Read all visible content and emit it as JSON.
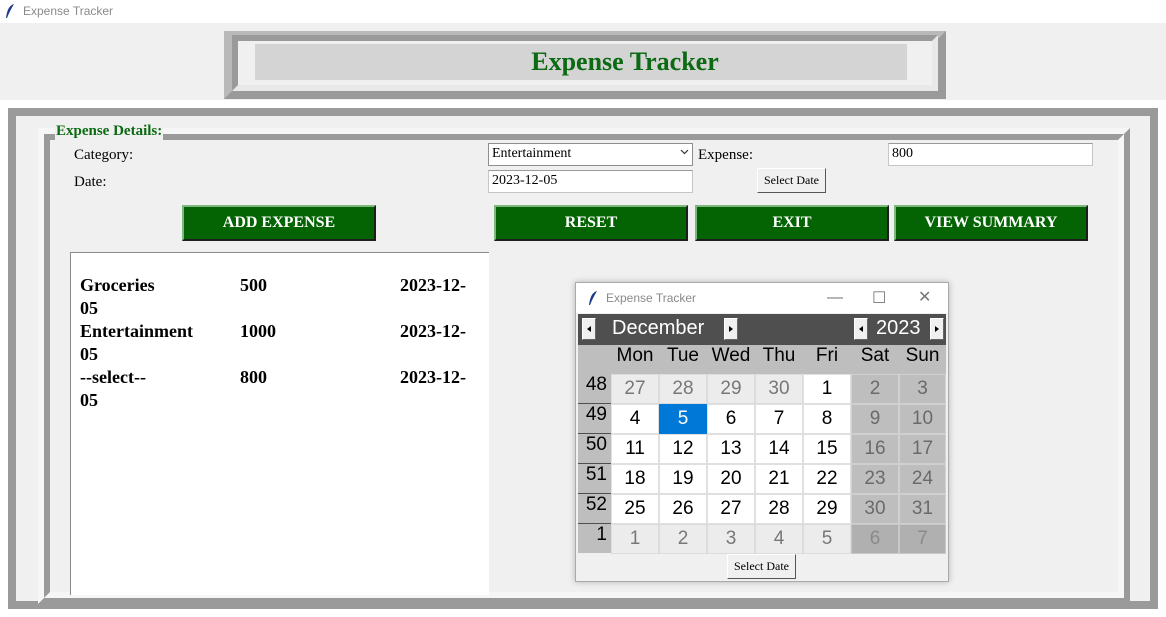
{
  "window": {
    "title": "Expense Tracker"
  },
  "header": {
    "title": "Expense Tracker"
  },
  "form": {
    "group_label": "Expense Details:",
    "category_label": "Category:",
    "category_value": "Entertainment",
    "expense_label": "Expense:",
    "expense_value": "800",
    "date_label": "Date:",
    "date_value": "2023-12-05",
    "select_date_label": "Select Date"
  },
  "buttons": {
    "add": "ADD EXPENSE",
    "reset": "RESET",
    "exit": "EXIT",
    "summary": "VIEW SUMMARY"
  },
  "expenses": [
    {
      "category": "Groceries",
      "amount": "500",
      "date_a": "2023-12-",
      "date_b": "05"
    },
    {
      "category": "Entertainment",
      "amount": "1000",
      "date_a": "2023-12-",
      "date_b": "05"
    },
    {
      "category": "--select--",
      "amount": "800",
      "date_a": "2023-12-",
      "date_b": "05"
    }
  ],
  "calendar_popup": {
    "title": "Expense Tracker",
    "month": "December",
    "year": "2023",
    "weekdays": [
      "Mon",
      "Tue",
      "Wed",
      "Thu",
      "Fri",
      "Sat",
      "Sun"
    ],
    "weeks": [
      {
        "num": "48",
        "days": [
          "27",
          "28",
          "29",
          "30",
          "1",
          "2",
          "3"
        ]
      },
      {
        "num": "49",
        "days": [
          "4",
          "5",
          "6",
          "7",
          "8",
          "9",
          "10"
        ]
      },
      {
        "num": "50",
        "days": [
          "11",
          "12",
          "13",
          "14",
          "15",
          "16",
          "17"
        ]
      },
      {
        "num": "51",
        "days": [
          "18",
          "19",
          "20",
          "21",
          "22",
          "23",
          "24"
        ]
      },
      {
        "num": "52",
        "days": [
          "25",
          "26",
          "27",
          "28",
          "29",
          "30",
          "31"
        ]
      },
      {
        "num": "1",
        "days": [
          "1",
          "2",
          "3",
          "4",
          "5",
          "6",
          "7"
        ]
      }
    ],
    "selected_day": "5",
    "button_label": "Select Date",
    "colors": {
      "selected": "#0078d7",
      "header": "#4f4f4f"
    }
  }
}
